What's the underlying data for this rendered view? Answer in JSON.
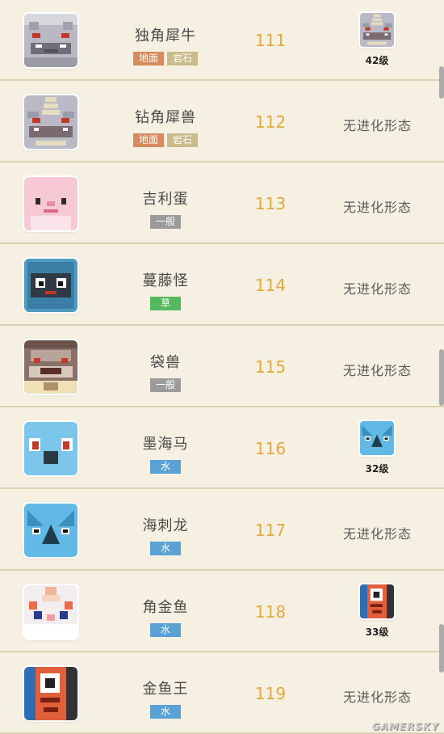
{
  "colors": {
    "ground": "#d98a5c",
    "rock": "#c9bb8c",
    "normal": "#9b9b9b",
    "grass": "#53b85e",
    "water": "#5aa2d6",
    "number": "#e2a93a"
  },
  "rows": [
    {
      "name": "独角犀牛",
      "types": [
        {
          "label": "地面",
          "kind": "ground"
        },
        {
          "label": "岩石",
          "kind": "rock"
        }
      ],
      "number": "111",
      "evolution": {
        "has_form": true,
        "level": "42级",
        "icon": "rhydon-icon"
      },
      "icon": "rhyhorn-icon"
    },
    {
      "name": "钻角犀兽",
      "types": [
        {
          "label": "地面",
          "kind": "ground"
        },
        {
          "label": "岩石",
          "kind": "rock"
        }
      ],
      "number": "112",
      "evolution": {
        "has_form": false,
        "text": "无进化形态"
      },
      "icon": "rhydon-icon"
    },
    {
      "name": "吉利蛋",
      "types": [
        {
          "label": "一般",
          "kind": "normal"
        }
      ],
      "number": "113",
      "evolution": {
        "has_form": false,
        "text": "无进化形态"
      },
      "icon": "chansey-icon"
    },
    {
      "name": "蔓藤怪",
      "types": [
        {
          "label": "草",
          "kind": "grass"
        }
      ],
      "number": "114",
      "evolution": {
        "has_form": false,
        "text": "无进化形态"
      },
      "icon": "tangela-icon"
    },
    {
      "name": "袋兽",
      "types": [
        {
          "label": "一般",
          "kind": "normal"
        }
      ],
      "number": "115",
      "evolution": {
        "has_form": false,
        "text": "无进化形态"
      },
      "icon": "kangaskhan-icon"
    },
    {
      "name": "墨海马",
      "types": [
        {
          "label": "水",
          "kind": "water"
        }
      ],
      "number": "116",
      "evolution": {
        "has_form": true,
        "level": "32级",
        "icon": "seadra-icon"
      },
      "icon": "horsea-icon"
    },
    {
      "name": "海刺龙",
      "types": [
        {
          "label": "水",
          "kind": "water"
        }
      ],
      "number": "117",
      "evolution": {
        "has_form": false,
        "text": "无进化形态"
      },
      "icon": "seadra-icon"
    },
    {
      "name": "角金鱼",
      "types": [
        {
          "label": "水",
          "kind": "water"
        }
      ],
      "number": "118",
      "evolution": {
        "has_form": true,
        "level": "33级",
        "icon": "seaking-icon"
      },
      "icon": "goldeen-icon"
    },
    {
      "name": "金鱼王",
      "types": [
        {
          "label": "水",
          "kind": "water"
        }
      ],
      "number": "119",
      "evolution": {
        "has_form": false,
        "text": "无进化形态"
      },
      "icon": "seaking-icon"
    }
  ],
  "watermark": "GAMERSKY"
}
